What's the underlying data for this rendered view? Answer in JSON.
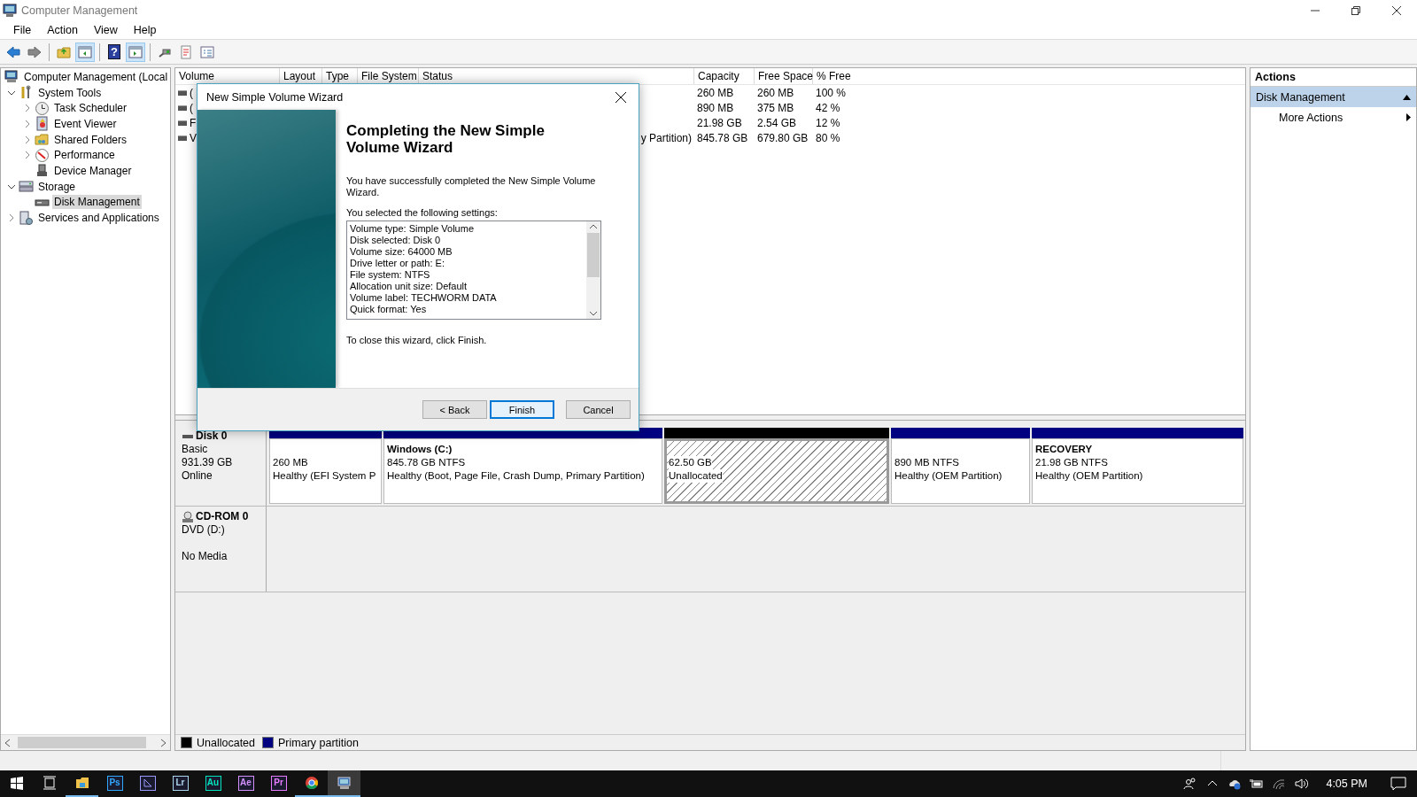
{
  "window": {
    "title": "Computer Management"
  },
  "menu": [
    "File",
    "Action",
    "View",
    "Help"
  ],
  "toolbar": [
    {
      "kind": "back",
      "pressed": false
    },
    {
      "kind": "forward",
      "pressed": false
    },
    {
      "kind": "separator"
    },
    {
      "kind": "up-folder",
      "pressed": false
    },
    {
      "kind": "console-tree",
      "pressed": true
    },
    {
      "kind": "separator"
    },
    {
      "kind": "help",
      "label": "?",
      "pressed": false
    },
    {
      "kind": "action-pane",
      "pressed": true
    },
    {
      "kind": "separator"
    },
    {
      "kind": "connect",
      "pressed": false
    },
    {
      "kind": "checklist",
      "pressed": false
    },
    {
      "kind": "properties",
      "pressed": false
    }
  ],
  "tree": [
    {
      "label": "Computer Management (Local",
      "kind": "computer",
      "selected": false,
      "children": [
        {
          "label": "System Tools",
          "kind": "tools",
          "expanded": true,
          "selected": false,
          "children": [
            {
              "label": "Task Scheduler",
              "kind": "clock",
              "expanded": false,
              "selected": false
            },
            {
              "label": "Event Viewer",
              "kind": "viewer",
              "expanded": false,
              "selected": false
            },
            {
              "label": "Shared Folders",
              "kind": "shared",
              "expanded": false,
              "selected": false
            },
            {
              "label": "Performance",
              "kind": "performance",
              "expanded": false,
              "selected": false
            },
            {
              "label": "Device Manager",
              "kind": "device",
              "selected": false
            }
          ]
        },
        {
          "label": "Storage",
          "kind": "storage",
          "expanded": true,
          "selected": false,
          "children": [
            {
              "label": "Disk Management",
              "kind": "disk",
              "selected": true
            }
          ]
        },
        {
          "label": "Services and Applications",
          "kind": "services",
          "expanded": false,
          "selected": false
        }
      ]
    }
  ],
  "volumes": {
    "columns": [
      "Volume",
      "Layout",
      "Type",
      "File System",
      "Status",
      "Capacity",
      "Free Space",
      "% Free"
    ],
    "rows": [
      {
        "cells": [
          "(",
          null,
          null,
          null,
          null,
          "260 MB",
          "260 MB",
          "100 %"
        ]
      },
      {
        "cells": [
          "(",
          null,
          null,
          null,
          null,
          "890 MB",
          "375 MB",
          "42 %"
        ]
      },
      {
        "cells": [
          "F",
          null,
          null,
          null,
          null,
          "21.98 GB",
          "2.54 GB",
          "12 %"
        ]
      },
      {
        "cells": [
          "V",
          null,
          null,
          null,
          "y Partition)",
          "845.78 GB",
          "679.80 GB",
          "80 %"
        ]
      }
    ]
  },
  "disks": [
    {
      "kind": "disk",
      "name": "Disk 0",
      "lines": [
        "Basic",
        "931.39 GB",
        "Online"
      ],
      "partitions": [
        {
          "kind": "primary",
          "selected": false,
          "lines": [
            "260 MB",
            "Healthy (EFI System P"
          ]
        },
        {
          "kind": "primary",
          "selected": false,
          "title": "Windows  (C:)",
          "lines": [
            "845.78 GB NTFS",
            "Healthy (Boot, Page File, Crash Dump, Primary Partition)"
          ]
        },
        {
          "kind": "unallocated",
          "selected": true,
          "lines": [
            "62.50 GB",
            "Unallocated"
          ]
        },
        {
          "kind": "primary",
          "selected": false,
          "lines": [
            "890 MB NTFS",
            "Healthy (OEM Partition)"
          ]
        },
        {
          "kind": "primary",
          "selected": false,
          "title": "RECOVERY",
          "lines": [
            "21.98 GB NTFS",
            "Healthy (OEM Partition)"
          ]
        }
      ]
    },
    {
      "kind": "cdrom",
      "name": "CD-ROM 0",
      "lines": [
        "DVD (D:)"
      ],
      "note": "No Media"
    }
  ],
  "legend": [
    {
      "label": "Unallocated",
      "color": "#000000"
    },
    {
      "label": "Primary partition",
      "color": "#000080"
    }
  ],
  "actions": {
    "title": "Actions",
    "items": [
      {
        "kind": "section",
        "label": "Disk Management",
        "expanded": true
      },
      {
        "kind": "submenu",
        "label": "More Actions"
      }
    ]
  },
  "dialog": {
    "title": "New Simple Volume Wizard",
    "heading": "Completing the New Simple Volume Wizard",
    "intro": "You have successfully completed the New Simple Volume Wizard.",
    "settings_label": "You selected the following settings:",
    "settings": [
      "Volume type: Simple Volume",
      "Disk selected: Disk 0",
      "Volume size: 64000 MB",
      "Drive letter or path: E:",
      "File system: NTFS",
      "Allocation unit size: Default",
      "Volume label: TECHWORM DATA",
      "Quick format: Yes"
    ],
    "closing": "To close this wizard, click Finish.",
    "buttons": [
      {
        "label": "< Back",
        "default": false
      },
      {
        "label": "Finish",
        "default": true
      },
      {
        "label": "Cancel",
        "default": false
      }
    ]
  },
  "taskbar": {
    "apps": [
      {
        "kind": "start",
        "running": false,
        "active": false
      },
      {
        "kind": "task-view",
        "running": false,
        "active": false
      },
      {
        "kind": "folder",
        "running": true,
        "active": false
      },
      {
        "kind": "badge",
        "label": "Ps",
        "color": "#31a8ff",
        "running": false,
        "active": false
      },
      {
        "kind": "encoder",
        "color": "#9999ff",
        "running": false,
        "active": false
      },
      {
        "kind": "badge",
        "label": "Lr",
        "color": "#add5ec",
        "running": false,
        "active": false
      },
      {
        "kind": "badge",
        "label": "Au",
        "color": "#00e4bb",
        "running": false,
        "active": false
      },
      {
        "kind": "badge",
        "label": "Ae",
        "color": "#d291ff",
        "running": false,
        "active": false
      },
      {
        "kind": "badge",
        "label": "Pr",
        "color": "#e77bff",
        "running": false,
        "active": false
      },
      {
        "kind": "chrome",
        "running": true,
        "active": false
      },
      {
        "kind": "computer",
        "running": true,
        "active": true
      }
    ],
    "tray": [
      {
        "kind": "people"
      },
      {
        "kind": "chevron"
      },
      {
        "kind": "cloud"
      },
      {
        "kind": "battery"
      },
      {
        "kind": "wifi"
      },
      {
        "kind": "volume"
      }
    ],
    "time": "4:05 PM"
  }
}
